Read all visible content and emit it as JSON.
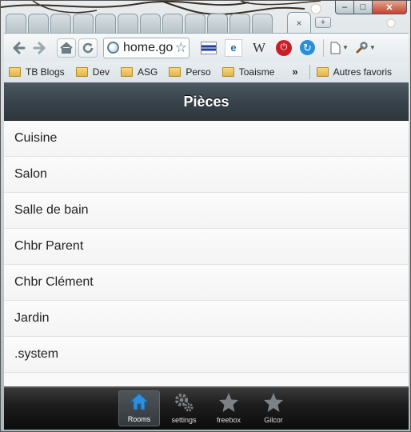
{
  "browser": {
    "active_tab_close": "×",
    "new_tab": "+",
    "window_controls": {
      "minimize": "–",
      "maximize": "□",
      "close": "✕"
    },
    "toolbar": {
      "back_icon": "arrow-left-icon",
      "forward_icon": "arrow-right-icon",
      "home_icon": "home-icon",
      "reload_icon": "reload-icon",
      "address": "home.go",
      "bookmark_star": "☆",
      "wiki_label": "W",
      "ie_label": "e",
      "stop_label": "⏻",
      "sync_label": "↻",
      "page_menu_icon": "page-icon",
      "wrench_menu_icon": "wrench-icon"
    },
    "bookmarks": [
      {
        "label": "TB Blogs"
      },
      {
        "label": "Dev"
      },
      {
        "label": "ASG"
      },
      {
        "label": "Perso"
      },
      {
        "label": "Toaisme"
      }
    ],
    "bookmarks_more": "»",
    "other_bookmarks": "Autres favoris"
  },
  "page": {
    "title": "Pièces",
    "rooms": [
      {
        "label": "Cuisine"
      },
      {
        "label": "Salon"
      },
      {
        "label": "Salle de bain"
      },
      {
        "label": "Chbr Parent"
      },
      {
        "label": "Chbr Clément"
      },
      {
        "label": "Jardin"
      },
      {
        "label": ".system"
      }
    ]
  },
  "footer": {
    "items": [
      {
        "label": "Rooms",
        "icon": "home-icon",
        "active": true
      },
      {
        "label": "settings",
        "icon": "gears-icon",
        "active": false
      },
      {
        "label": "freebox",
        "icon": "star-icon",
        "active": false
      },
      {
        "label": "Gilcor",
        "icon": "star-icon",
        "active": false
      }
    ]
  },
  "colors": {
    "header_bg": "#39444c",
    "footer_bg": "#1d1d1d",
    "active_nav_icon": "#2e8ee0",
    "inactive_nav_icon": "#7a8288"
  }
}
